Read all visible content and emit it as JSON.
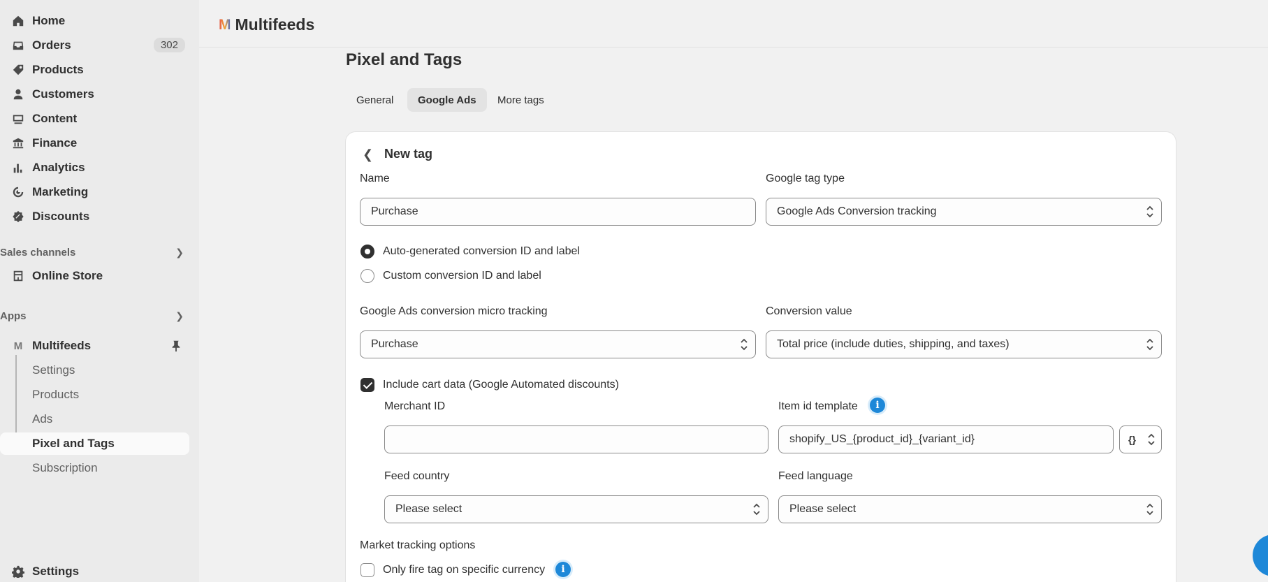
{
  "sidebar": {
    "items": [
      {
        "label": "Home",
        "icon": "home-icon"
      },
      {
        "label": "Orders",
        "icon": "inbox-icon",
        "badge": "302"
      },
      {
        "label": "Products",
        "icon": "tag-icon"
      },
      {
        "label": "Customers",
        "icon": "person-icon"
      },
      {
        "label": "Content",
        "icon": "image-icon"
      },
      {
        "label": "Finance",
        "icon": "bank-icon"
      },
      {
        "label": "Analytics",
        "icon": "bar-chart-icon"
      },
      {
        "label": "Marketing",
        "icon": "target-icon"
      },
      {
        "label": "Discounts",
        "icon": "discount-icon"
      }
    ],
    "sales_channels": {
      "header": "Sales channels",
      "online_store": "Online Store"
    },
    "apps": {
      "header": "Apps",
      "app_name": "Multifeeds",
      "sub_items": [
        "Settings",
        "Products",
        "Ads",
        "Pixel and Tags",
        "Subscription"
      ],
      "active": "Pixel and Tags"
    },
    "settings": "Settings"
  },
  "topbar": {
    "brand": "Multifeeds",
    "logo_letter": "M"
  },
  "page": {
    "title": "Pixel and Tags",
    "tabs": [
      "General",
      "Google Ads",
      "More tags"
    ],
    "active_tab": "Google Ads"
  },
  "form": {
    "card_title": "New tag",
    "name_label": "Name",
    "name_value": "Purchase",
    "tag_type_label": "Google tag type",
    "tag_type_value": "Google Ads Conversion tracking",
    "radio_auto": "Auto-generated conversion ID and label",
    "radio_custom": "Custom conversion ID and label",
    "radio_selected": "auto",
    "micro_label": "Google Ads conversion micro tracking",
    "micro_value": "Purchase",
    "conv_value_label": "Conversion value",
    "conv_value_value": "Total price (include duties, shipping, and taxes)",
    "cart_checkbox": "Include cart data (Google Automated discounts)",
    "cart_checked": true,
    "merchant_label": "Merchant ID",
    "merchant_value": "",
    "item_template_label": "Item id template",
    "item_template_value": "shopify_US_{product_id}_{variant_id}",
    "template_button": "{}",
    "feed_country_label": "Feed country",
    "feed_country_value": "Please select",
    "feed_language_label": "Feed language",
    "feed_language_value": "Please select",
    "market_label": "Market tracking options",
    "currency_checkbox": "Only fire tag on specific currency",
    "currency_checked": false
  },
  "colors": {
    "accent": "#1e88d8",
    "sidebar_bg": "#ebebeb",
    "page_bg": "#f1f1f1"
  }
}
